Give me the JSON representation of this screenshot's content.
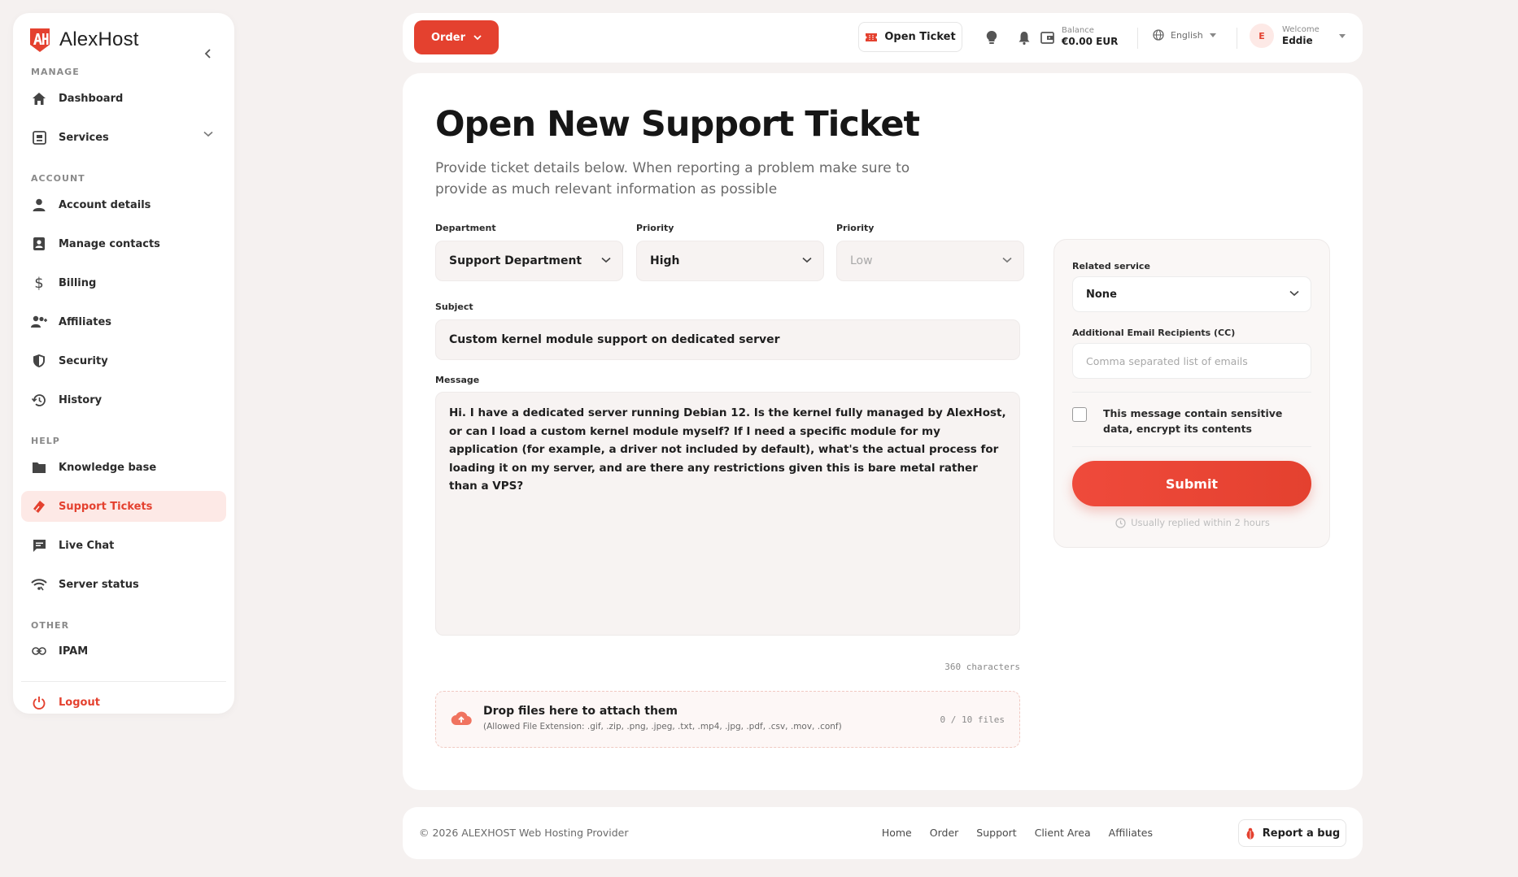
{
  "brand": {
    "name": "AlexHost",
    "accent": "#e4412f"
  },
  "sidebar": {
    "sections": {
      "manage": "MANAGE",
      "account": "ACCOUNT",
      "help": "HELP",
      "other": "OTHER"
    },
    "items": {
      "dashboard": "Dashboard",
      "services": "Services",
      "account_details": "Account details",
      "manage_contacts": "Manage contacts",
      "billing": "Billing",
      "affiliates": "Affiliates",
      "security": "Security",
      "history": "History",
      "knowledge_base": "Knowledge base",
      "support_tickets": "Support Tickets",
      "live_chat": "Live Chat",
      "server_status": "Server status",
      "ipam": "IPAM",
      "logout": "Logout"
    },
    "active": "support_tickets"
  },
  "topbar": {
    "order_label": "Order",
    "open_ticket_label": "Open Ticket",
    "balance_label": "Balance",
    "balance_value": "€0.00 EUR",
    "language": "English",
    "welcome_label": "Welcome",
    "user_name": "Eddie",
    "user_initial": "E"
  },
  "page": {
    "title": "Open New Support Ticket",
    "subtitle": "Provide ticket details below. When reporting a problem make sure to provide as much relevant information as possible"
  },
  "form": {
    "department_label": "Department",
    "department_value": "Support Department",
    "priority_label": "Priority",
    "priority_value": "High",
    "priority2_label": "Priority",
    "priority2_value": "Low",
    "subject_label": "Subject",
    "subject_value": "Custom kernel module support on dedicated server",
    "message_label": "Message",
    "message_value": "Hi. I have a dedicated server running Debian 12. Is the kernel fully managed by AlexHost, or can I load a custom kernel module myself? If I need a specific module for my application (for example, a driver not included by default), what's the actual process for loading it on my server, and are there any restrictions given this is bare metal rather than a VPS?",
    "char_count": "360 characters",
    "dropzone_title": "Drop files here to attach them",
    "dropzone_sub": "(Allowed File Extension: .gif, .zip, .png, .jpeg, .txt, .mp4, .jpg, .pdf, .csv, .mov, .conf)",
    "file_count": "0 / 10 files"
  },
  "side_panel": {
    "related_service_label": "Related service",
    "related_service_value": "None",
    "cc_label": "Additional Email Recipients (CC)",
    "cc_placeholder": "Comma separated list of emails",
    "sensitive_label": "This message contain sensitive data, encrypt its contents",
    "sensitive_checked": false,
    "submit_label": "Submit",
    "reply_note": "Usually replied within 2 hours"
  },
  "footer": {
    "copyright": "© 2026 ALEXHOST Web Hosting Provider",
    "links": [
      "Home",
      "Order",
      "Support",
      "Client Area",
      "Affiliates"
    ],
    "report_bug": "Report a bug"
  }
}
